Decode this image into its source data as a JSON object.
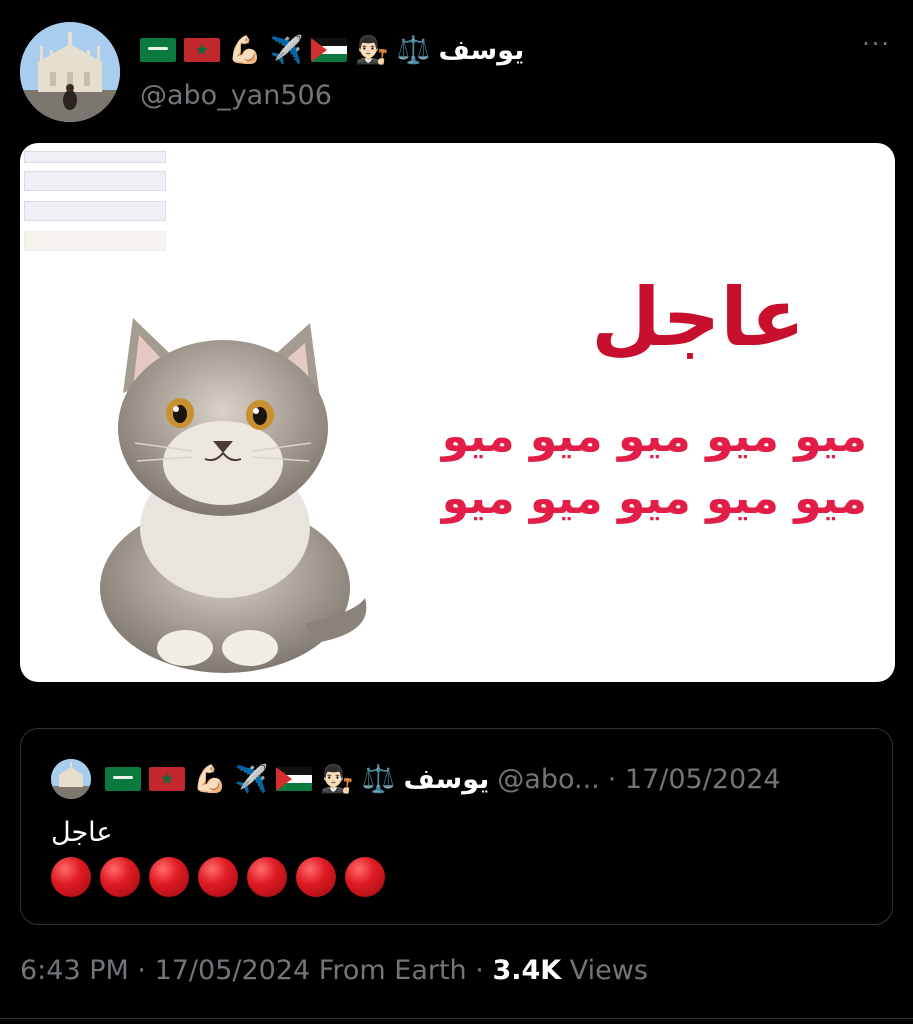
{
  "author": {
    "name": "يوسف",
    "handle": "@abo_yan506",
    "emojis": [
      "saudi-flag",
      "morocco-flag",
      "flexed-bicep",
      "airplane",
      "palestine-flag",
      "man-judge",
      "balance-scale"
    ]
  },
  "media": {
    "headline": "عاجل",
    "line1": "ميو ميو ميو ميو ميو",
    "line2": "ميو ميو ميو ميو ميو"
  },
  "quote": {
    "name": "يوسف",
    "handle": "@abo...",
    "date": "· 17/05/2024",
    "text": "عاجل",
    "red_circles": 7
  },
  "footer": {
    "time": "6:43 PM",
    "date": "17/05/2024",
    "source": "From Earth",
    "views_count": "3.4K",
    "views_label": "Views"
  },
  "colors": {
    "bg": "#000000",
    "muted": "#71767b",
    "headline_red": "#c8102e",
    "meow_red": "#e11d48"
  }
}
